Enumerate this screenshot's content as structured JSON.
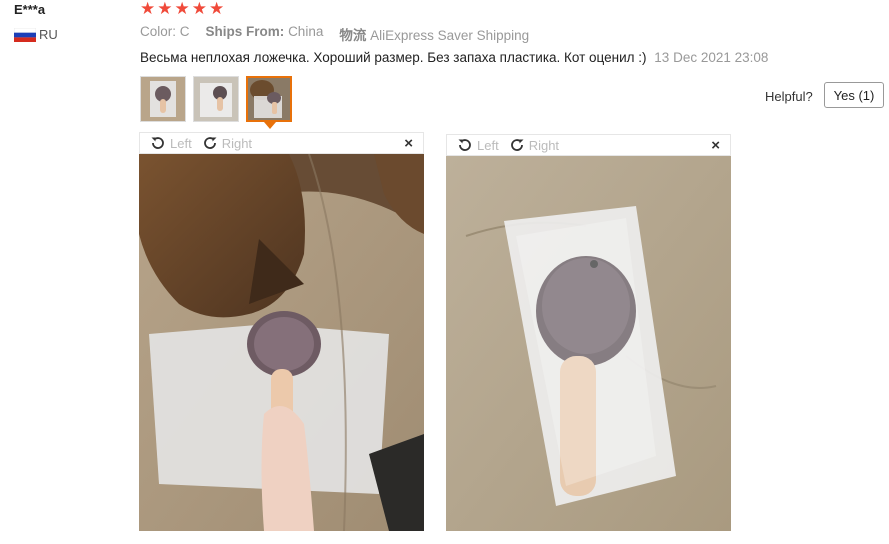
{
  "user": {
    "name": "E***a",
    "country": "RU",
    "flag_colors": [
      "#ffffff",
      "#1c3fb8",
      "#d52b1e"
    ]
  },
  "rating": {
    "stars": 5,
    "max": 5,
    "star_glyph": "★",
    "color": "#f04a3a"
  },
  "meta": {
    "color_label": "Color:",
    "color_value": "C",
    "ships_label": "Ships From:",
    "ships_value": "China",
    "shipping_label": "物流",
    "shipping_value": "AliExpress Saver Shipping"
  },
  "review": {
    "text": "Весьма неплохая ложечка. Хороший размер. Без запаха пластика. Кот оценил :)",
    "date": "13 Dec 2021 23:08"
  },
  "thumbnails": [
    {
      "name": "photo-1",
      "active": false
    },
    {
      "name": "photo-2",
      "active": false
    },
    {
      "name": "photo-3",
      "active": true
    }
  ],
  "helpful": {
    "label": "Helpful?",
    "yes_button": "Yes (1)"
  },
  "viewers": [
    {
      "rotate_left": "Left",
      "rotate_right": "Right",
      "close": "×"
    },
    {
      "rotate_left": "Left",
      "rotate_right": "Right",
      "close": "×"
    }
  ],
  "icons": {
    "rotate_left": "rotate-left-icon",
    "rotate_right": "rotate-right-icon",
    "close": "close-icon",
    "star": "star-icon",
    "flag": "flag-ru-icon"
  }
}
